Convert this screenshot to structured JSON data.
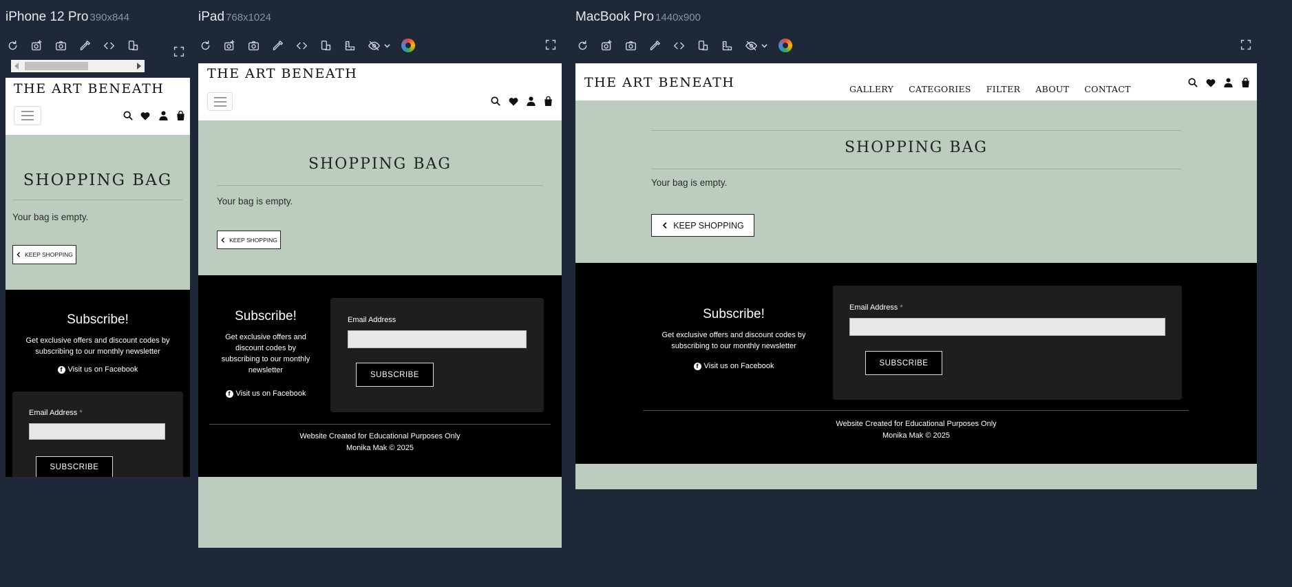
{
  "devices": {
    "iphone": {
      "name": "iPhone 12 Pro",
      "size": "390x844"
    },
    "ipad": {
      "name": "iPad",
      "size": "768x1024"
    },
    "macbook": {
      "name": "MacBook Pro",
      "size": "1440x900"
    }
  },
  "toolbar_icons": [
    "refresh-icon",
    "screenshot-icon",
    "camera-icon",
    "eyedropper-icon",
    "code-icon",
    "rotate-icon",
    "ruler-icon",
    "visibility-icon",
    "color-picker-icon",
    "expand-icon"
  ],
  "site": {
    "logo": "THE ART BENEATH",
    "nav": [
      "GALLERY",
      "CATEGORIES",
      "FILTER",
      "ABOUT",
      "CONTACT"
    ],
    "page_title": "SHOPPING BAG",
    "empty_message": "Your bag is empty.",
    "keep_shopping": "KEEP SHOPPING",
    "subscribe_title": "Subscribe!",
    "subscribe_desc": "Get exclusive offers and discount codes by subscribing to our monthly newsletter",
    "facebook": "Visit us on Facebook",
    "email_label": "Email Address",
    "required_mark": "*",
    "subscribe_button": "SUBSCRIBE",
    "credit": "Website Created for Educational Purposes Only",
    "copyright": "Monika Mak © 2025"
  },
  "colors": {
    "app_bg": "#1f2838",
    "page_bg": "#bcccbf",
    "footer_bg": "#000000",
    "form_bg": "#1e1e1e"
  }
}
